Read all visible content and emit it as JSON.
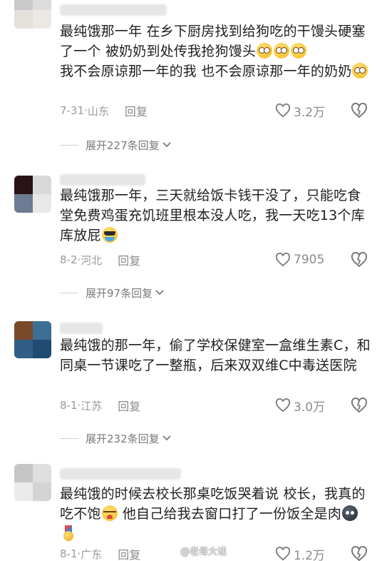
{
  "comments": [
    {
      "text": "最纯饿那一年 在乡下厨房找到给狗吃的干馒头硬塞了一个 被奶奶到处传我抢狗馒头",
      "text2": "我不会原谅那一年的我 也不会原谅那一年的奶奶",
      "date": "7-31",
      "location": "山东",
      "reply_label": "回复",
      "likes": "3.2万",
      "expand": "展开227条回复"
    },
    {
      "text": "最纯饿那一年，三天就给饭卡钱干没了，只能吃食堂免费鸡蛋充饥班里根本没人吃，我一天吃13个库库放屁",
      "date": "8-2",
      "location": "河北",
      "reply_label": "回复",
      "likes": "7905",
      "expand": "展开97条回复"
    },
    {
      "text": "最纯饿的那一年，偷了学校保健室一盒维生素C，和同桌一节课吃了一整瓶，后来双双维C中毒送医院",
      "date": "8-1",
      "location": "江苏",
      "reply_label": "回复",
      "likes": "3.0万",
      "expand": "展开232条回复"
    },
    {
      "text": "最纯饿的时候去校长那桌吃饭哭着说 校长，我真的吃不饱",
      "text2": "他自己给我去窗口打了一份饭全是肉",
      "date": "8-1",
      "location": "广东",
      "reply_label": "回复",
      "likes": "1.2万"
    }
  ],
  "watermark": "@老母大话",
  "icons": {
    "like": "heart-outline-icon",
    "dislike": "broken-heart-icon",
    "expand": "chevron-down-icon"
  }
}
